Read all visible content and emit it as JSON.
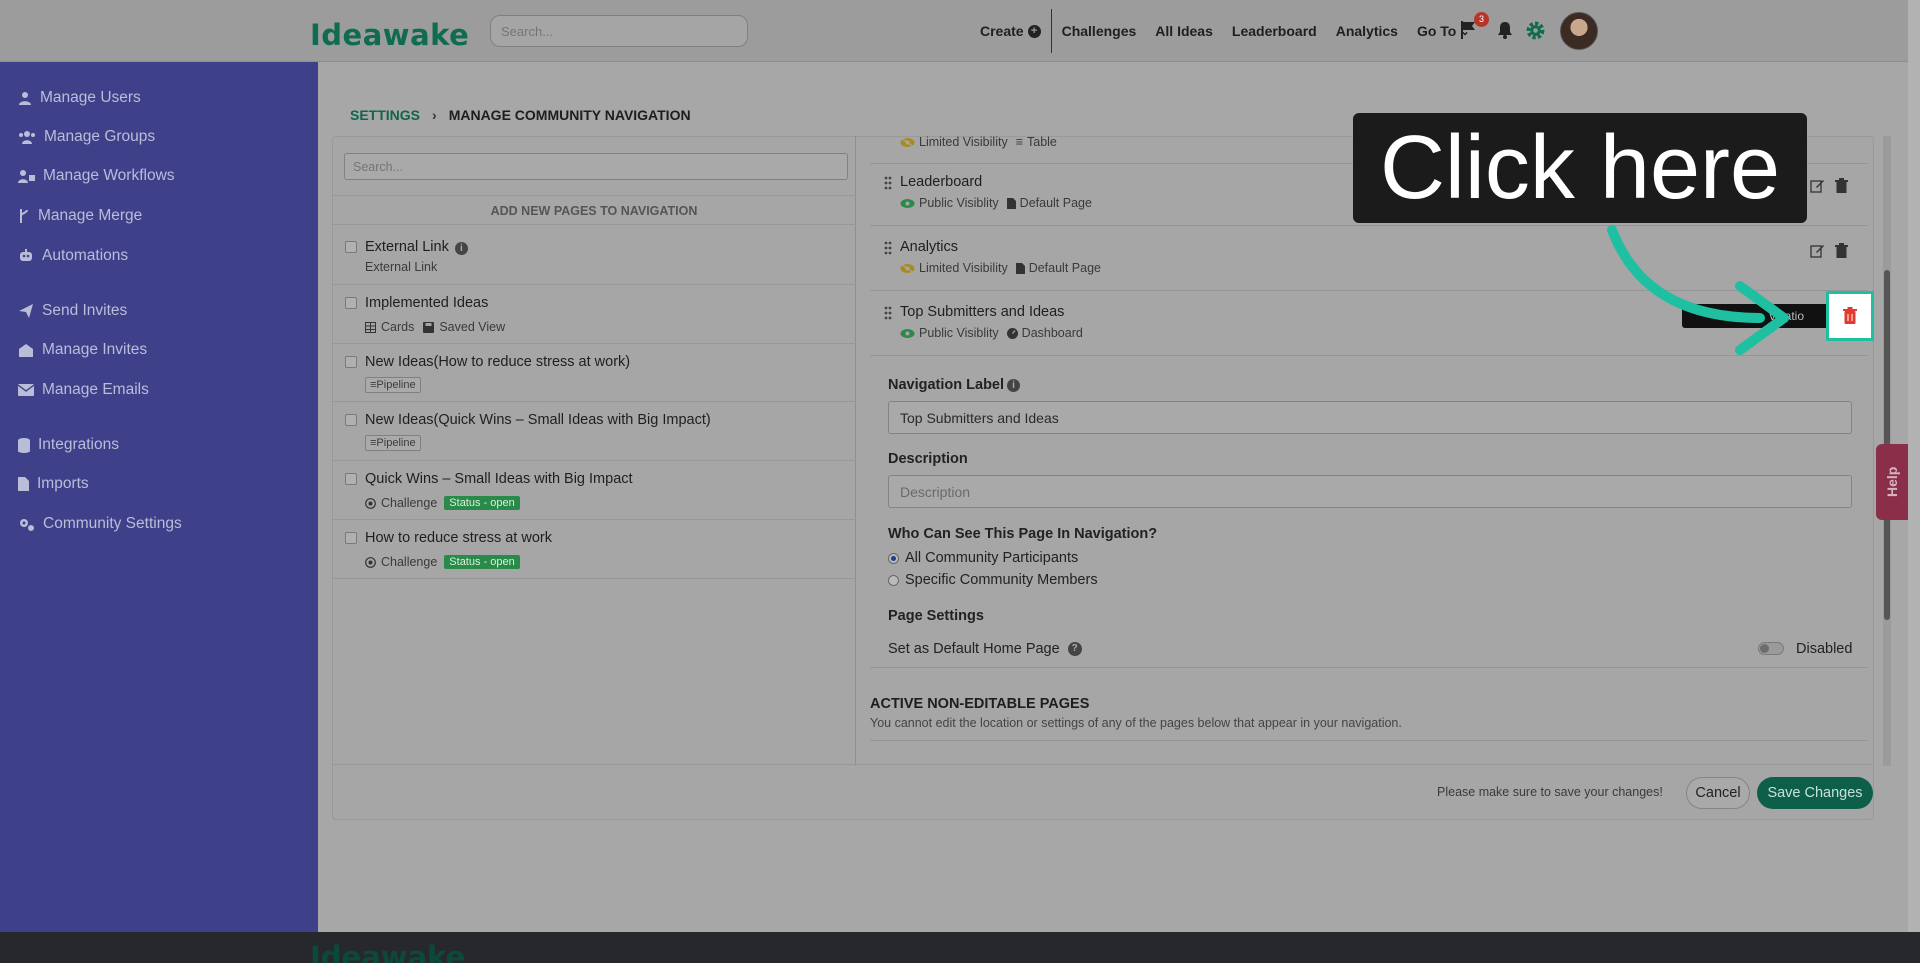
{
  "header": {
    "logo": "Ideawake",
    "search_placeholder": "Search...",
    "nav": {
      "create": "Create",
      "challenges": "Challenges",
      "all_ideas": "All Ideas",
      "leaderboard": "Leaderboard",
      "analytics": "Analytics",
      "go_to": "Go To"
    },
    "notification_count": "3"
  },
  "sidebar": {
    "items": [
      {
        "label": "Manage Users",
        "icon": "user-icon"
      },
      {
        "label": "Manage Groups",
        "icon": "users-icon"
      },
      {
        "label": "Manage Workflows",
        "icon": "workflow-icon"
      },
      {
        "label": "Manage Merge",
        "icon": "merge-icon"
      },
      {
        "label": "Automations",
        "icon": "robot-icon"
      },
      {
        "label": "Send Invites",
        "icon": "send-icon"
      },
      {
        "label": "Manage Invites",
        "icon": "invite-icon"
      },
      {
        "label": "Manage Emails",
        "icon": "envelope-icon"
      },
      {
        "label": "Integrations",
        "icon": "database-icon"
      },
      {
        "label": "Imports",
        "icon": "file-icon"
      },
      {
        "label": "Community Settings",
        "icon": "cogs-icon"
      }
    ]
  },
  "breadcrumb": {
    "root": "SETTINGS",
    "current": "MANAGE COMMUNITY NAVIGATION"
  },
  "left_panel": {
    "search_placeholder": "Search...",
    "title": "ADD NEW PAGES TO NAVIGATION",
    "pages": [
      {
        "title": "External Link",
        "meta": "External Link"
      },
      {
        "title": "Implemented Ideas",
        "meta_1": "Cards",
        "meta_2": "Saved View"
      },
      {
        "title": "New Ideas(How to reduce stress at work)",
        "tag": "Pipeline"
      },
      {
        "title": "New Ideas(Quick Wins – Small Ideas with Big Impact)",
        "tag": "Pipeline"
      },
      {
        "title": "Quick Wins – Small Ideas with Big Impact",
        "meta": "Challenge",
        "status": "Status - open"
      },
      {
        "title": "How to reduce stress at work",
        "meta": "Challenge",
        "status": "Status - open"
      }
    ]
  },
  "nav_items": [
    {
      "title": "",
      "visibility": "Limited Visibility",
      "type": "Table"
    },
    {
      "title": "Leaderboard",
      "visibility": "Public Visiblity",
      "type": "Default Page"
    },
    {
      "title": "Analytics",
      "visibility": "Limited Visibility",
      "type": "Default Page"
    },
    {
      "title": "Top Submitters and Ideas",
      "visibility": "Public Visiblity",
      "type": "Dashboard"
    }
  ],
  "tooltip_text": "vigatio",
  "form": {
    "nav_label_title": "Navigation Label",
    "nav_label_value": "Top Submitters and Ideas",
    "description_title": "Description",
    "description_placeholder": "Description",
    "who_title": "Who Can See This Page In Navigation?",
    "option_all": "All Community Participants",
    "option_specific": "Specific Community Members",
    "page_settings_title": "Page Settings",
    "default_home_label": "Set as Default Home Page",
    "toggle_state": "Disabled"
  },
  "non_editable": {
    "title": "ACTIVE NON-EDITABLE PAGES",
    "subtitle": "You cannot edit the location or settings of any of the pages below that appear in your navigation."
  },
  "footer_actions": {
    "note": "Please make sure to save your changes!",
    "cancel": "Cancel",
    "save": "Save Changes"
  },
  "help_label": "Help",
  "overlay": {
    "callout": "Click here"
  },
  "colors": {
    "brand": "#0f6b51",
    "sidebar": "#3f408a",
    "highlight": "#1fbfa2",
    "delete": "#e23a2e"
  }
}
